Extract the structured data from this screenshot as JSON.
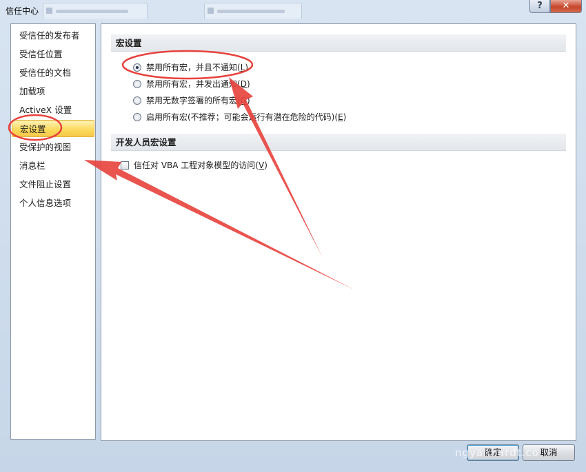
{
  "window": {
    "title": "信任中心",
    "help_glyph": "?",
    "close_glyph": "✕"
  },
  "nav": {
    "items": [
      {
        "label": "受信任的发布者"
      },
      {
        "label": "受信任位置"
      },
      {
        "label": "受信任的文档"
      },
      {
        "label": "加载项"
      },
      {
        "label": "ActiveX 设置"
      },
      {
        "label": "宏设置",
        "selected": true
      },
      {
        "label": "受保护的视图"
      },
      {
        "label": "消息栏"
      },
      {
        "label": "文件阻止设置"
      },
      {
        "label": "个人信息选项"
      }
    ]
  },
  "macro_section": {
    "title": "宏设置",
    "options": [
      {
        "label": "禁用所有宏，并且不通知",
        "key": "L",
        "checked": true
      },
      {
        "label": "禁用所有宏，并发出通知",
        "key": "D",
        "checked": false
      },
      {
        "label": "禁用无数字签署的所有宏",
        "key": "G",
        "checked": false
      },
      {
        "label": "启用所有宏(不推荐；可能会运行有潜在危险的代码)",
        "key": "E",
        "checked": false
      }
    ]
  },
  "developer_section": {
    "title": "开发人员宏设置",
    "checkbox": {
      "label": "信任对 VBA 工程对象模型的访问",
      "key": "V",
      "checked": false
    }
  },
  "buttons": {
    "ok": "确定",
    "cancel": "取消"
  },
  "watermark": "ngyanhardt.co",
  "annotation_color": "#e8413c"
}
